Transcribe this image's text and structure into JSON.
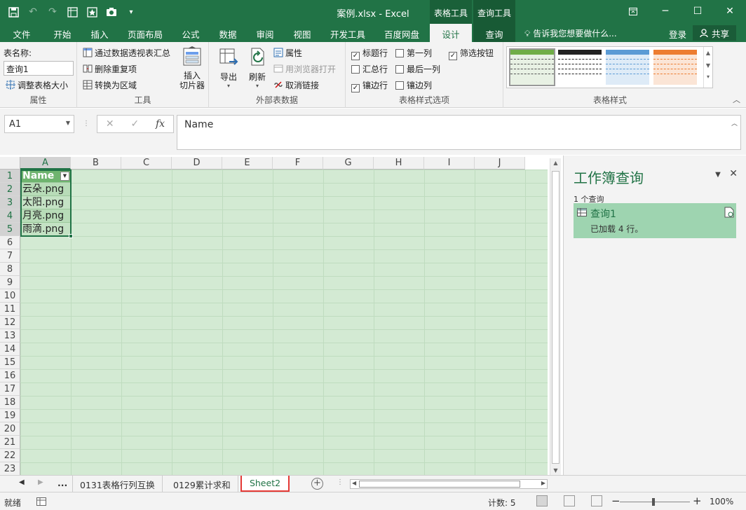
{
  "window": {
    "title": "案例.xlsx - Excel",
    "context_tabs": [
      "表格工具",
      "查询工具"
    ]
  },
  "ribbon_tabs": [
    "文件",
    "开始",
    "插入",
    "页面布局",
    "公式",
    "数据",
    "审阅",
    "视图",
    "开发工具",
    "百度网盘",
    "设计",
    "查询"
  ],
  "tell_me": "告诉我您想要做什么...",
  "signin": "登录",
  "share": "共享",
  "groups": {
    "properties": {
      "label": "属性",
      "table_name_label": "表名称:",
      "table_name_value": "查询1",
      "resize": "调整表格大小"
    },
    "tools": {
      "label": "工具",
      "pivot": "通过数据透视表汇总",
      "remove_dup": "删除重复项",
      "convert": "转换为区域",
      "slicer": "插入\n切片器"
    },
    "external": {
      "label": "外部表数据",
      "export": "导出",
      "refresh": "刷新",
      "props": "属性",
      "open_browser": "用浏览器打开",
      "unlink": "取消链接"
    },
    "style_options": {
      "label": "表格样式选项",
      "header_row": "标题行",
      "total_row": "汇总行",
      "banded_rows": "镶边行",
      "first_col": "第一列",
      "last_col": "最后一列",
      "banded_cols": "镶边列",
      "filter_btn": "筛选按钮"
    },
    "table_styles": {
      "label": "表格样式",
      "swatches": [
        "#70ad47",
        "#222222",
        "#5b9bd5",
        "#ed7d31"
      ]
    }
  },
  "formula_bar": {
    "cell_ref": "A1",
    "cancel": "✕",
    "enter": "✓",
    "fx": "fx",
    "formula": "Name"
  },
  "columns": [
    "A",
    "B",
    "C",
    "D",
    "E",
    "F",
    "G",
    "H",
    "I",
    "J"
  ],
  "rows": [
    "1",
    "2",
    "3",
    "4",
    "5",
    "6",
    "7",
    "8",
    "9",
    "10",
    "11",
    "12",
    "13",
    "14",
    "15",
    "16",
    "17",
    "18",
    "19",
    "20",
    "21",
    "22",
    "23"
  ],
  "table": {
    "header": "Name",
    "values": [
      "云朵.png",
      "太阳.png",
      "月亮.png",
      "雨滴.png"
    ]
  },
  "query_pane": {
    "title": "工作簿查询",
    "count": "1 个查询",
    "query_name": "查询1",
    "query_status": "已加载 4 行。"
  },
  "sheets": [
    "...",
    "0131表格行列互换",
    "0129累计求和",
    "Sheet2"
  ],
  "status": {
    "ready": "就绪",
    "count": "计数: 5",
    "zoom": "100%"
  }
}
